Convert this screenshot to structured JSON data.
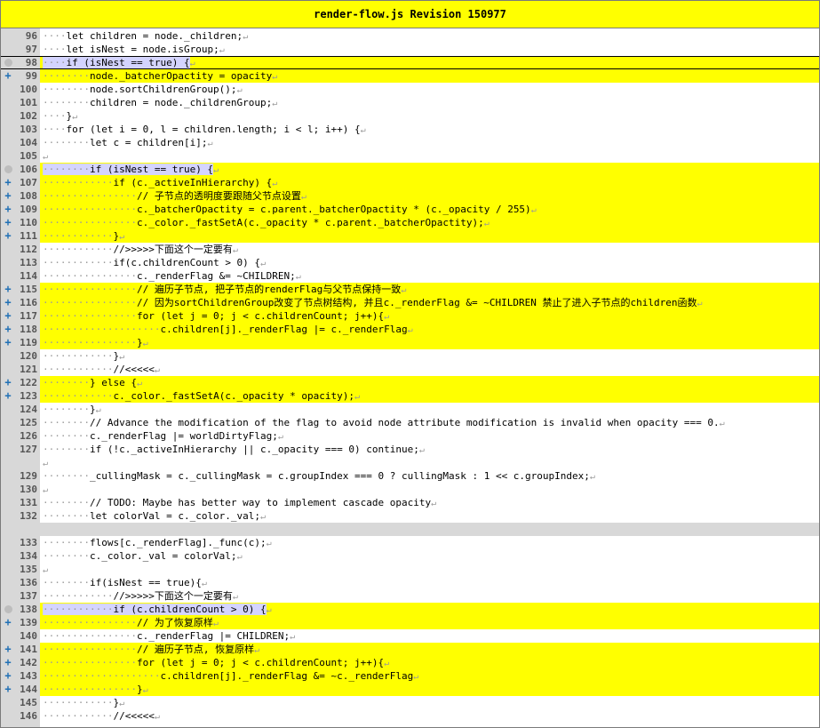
{
  "window": {
    "title": "render-flow.js Revision 150977"
  },
  "colors": {
    "highlight": "#ffff00",
    "gutter": "#d8d8d8",
    "marker": "#1f6fb5",
    "selection": "#d4d4ff"
  },
  "lines_top": [
    {
      "n": "96",
      "ind": 4,
      "code": "let children = node._children;",
      "hl": false,
      "mark": ""
    },
    {
      "n": "97",
      "ind": 4,
      "code": "let isNest = node.isGroup;",
      "hl": false,
      "mark": ""
    },
    {
      "n": "98",
      "ind": 4,
      "code": "if (isNest == true) {",
      "hl": true,
      "mark": "circle",
      "outlined": true,
      "sel": true
    },
    {
      "n": "99",
      "ind": 8,
      "code": "node._batcherOpactity = opacity",
      "hl": true,
      "mark": "plus"
    },
    {
      "n": "100",
      "ind": 8,
      "code": "node.sortChildrenGroup();",
      "hl": false,
      "mark": ""
    },
    {
      "n": "101",
      "ind": 8,
      "code": "children = node._childrenGroup;",
      "hl": false,
      "mark": ""
    },
    {
      "n": "102",
      "ind": 4,
      "code": "}",
      "hl": false,
      "mark": ""
    },
    {
      "n": "103",
      "ind": 4,
      "code": "for (let i = 0, l = children.length; i < l; i++) {",
      "hl": false,
      "mark": ""
    },
    {
      "n": "104",
      "ind": 8,
      "code": "let c = children[i];",
      "hl": false,
      "mark": ""
    },
    {
      "n": "105",
      "ind": 0,
      "code": "",
      "hl": false,
      "mark": ""
    },
    {
      "n": "106",
      "ind": 8,
      "code": "if (isNest == true) {",
      "hl": true,
      "mark": "circle",
      "sel": true
    },
    {
      "n": "107",
      "ind": 12,
      "code": "if (c._activeInHierarchy) {",
      "hl": true,
      "mark": "plus"
    },
    {
      "n": "108",
      "ind": 16,
      "code": "// 子节点的透明度要跟随父节点设置",
      "hl": true,
      "mark": "plus"
    },
    {
      "n": "109",
      "ind": 16,
      "code": "c._batcherOpactity = c.parent._batcherOpactity * (c._opacity / 255)",
      "hl": true,
      "mark": "plus"
    },
    {
      "n": "110",
      "ind": 16,
      "code": "c._color._fastSetA(c._opacity * c.parent._batcherOpactity);",
      "hl": true,
      "mark": "plus"
    },
    {
      "n": "111",
      "ind": 12,
      "code": "}",
      "hl": true,
      "mark": "plus"
    },
    {
      "n": "112",
      "ind": 12,
      "code": "//>>>>>下面这个一定要有",
      "hl": false,
      "mark": ""
    },
    {
      "n": "113",
      "ind": 12,
      "code": "if(c.childrenCount > 0) {",
      "hl": false,
      "mark": ""
    },
    {
      "n": "114",
      "ind": 16,
      "code": "c._renderFlag &= ~CHILDREN;",
      "hl": false,
      "mark": ""
    },
    {
      "n": "115",
      "ind": 16,
      "code": "// 遍历子节点, 把子节点的renderFlag与父节点保持一致",
      "hl": true,
      "mark": "plus"
    },
    {
      "n": "116",
      "ind": 16,
      "code": "// 因为sortChildrenGroup改变了节点树结构, 并且c._renderFlag &= ~CHILDREN 禁止了进入子节点的children函数",
      "hl": true,
      "mark": "plus"
    },
    {
      "n": "117",
      "ind": 16,
      "code": "for (let j = 0; j < c.childrenCount; j++){",
      "hl": true,
      "mark": "plus"
    },
    {
      "n": "118",
      "ind": 20,
      "code": "c.children[j]._renderFlag |= c._renderFlag",
      "hl": true,
      "mark": "plus"
    },
    {
      "n": "119",
      "ind": 16,
      "code": "}",
      "hl": true,
      "mark": "plus"
    },
    {
      "n": "120",
      "ind": 12,
      "code": "}",
      "hl": false,
      "mark": ""
    },
    {
      "n": "121",
      "ind": 12,
      "code": "//<<<<<",
      "hl": false,
      "mark": ""
    },
    {
      "n": "122",
      "ind": 8,
      "code": "} else {",
      "hl": true,
      "mark": "plus"
    },
    {
      "n": "123",
      "ind": 12,
      "code": "c._color._fastSetA(c._opacity * opacity);",
      "hl": true,
      "mark": "plus"
    },
    {
      "n": "124",
      "ind": 8,
      "code": "}",
      "hl": false,
      "mark": ""
    },
    {
      "n": "125",
      "ind": 8,
      "code": "// Advance the modification of the flag to avoid node attribute modification is invalid when opacity === 0.",
      "hl": false,
      "mark": ""
    },
    {
      "n": "126",
      "ind": 8,
      "code": "c._renderFlag |= worldDirtyFlag;",
      "hl": false,
      "mark": ""
    },
    {
      "n": "127",
      "ind": 8,
      "code": "if (!c._activeInHierarchy || c._opacity === 0) continue;",
      "hl": false,
      "mark": ""
    },
    {
      "n": "",
      "ind": 0,
      "code": "",
      "hl": false,
      "mark": ""
    },
    {
      "n": "129",
      "ind": 8,
      "code": "_cullingMask = c._cullingMask = c.groupIndex === 0 ? cullingMask : 1 << c.groupIndex;",
      "hl": false,
      "mark": ""
    },
    {
      "n": "130",
      "ind": 0,
      "code": "",
      "hl": false,
      "mark": ""
    },
    {
      "n": "131",
      "ind": 8,
      "code": "// TODO: Maybe has better way to implement cascade opacity",
      "hl": false,
      "mark": ""
    },
    {
      "n": "132",
      "ind": 8,
      "code": "let colorVal = c._color._val;",
      "hl": false,
      "mark": ""
    }
  ],
  "lines_bottom": [
    {
      "n": "133",
      "ind": 8,
      "code": "flows[c._renderFlag]._func(c);",
      "hl": false,
      "mark": ""
    },
    {
      "n": "134",
      "ind": 8,
      "code": "c._color._val = colorVal;",
      "hl": false,
      "mark": ""
    },
    {
      "n": "135",
      "ind": 0,
      "code": "",
      "hl": false,
      "mark": ""
    },
    {
      "n": "136",
      "ind": 8,
      "code": "if(isNest == true){",
      "hl": false,
      "mark": ""
    },
    {
      "n": "137",
      "ind": 12,
      "code": "//>>>>>下面这个一定要有",
      "hl": false,
      "mark": ""
    },
    {
      "n": "138",
      "ind": 12,
      "code": "if (c.childrenCount > 0) {",
      "hl": true,
      "mark": "circle",
      "sel": true
    },
    {
      "n": "139",
      "ind": 16,
      "code": "// 为了恢复原样",
      "hl": true,
      "mark": "plus"
    },
    {
      "n": "140",
      "ind": 16,
      "code": "c._renderFlag |= CHILDREN;",
      "hl": false,
      "mark": ""
    },
    {
      "n": "141",
      "ind": 16,
      "code": "// 遍历子节点, 恢复原样",
      "hl": true,
      "mark": "plus"
    },
    {
      "n": "142",
      "ind": 16,
      "code": "for (let j = 0; j < c.childrenCount; j++){",
      "hl": true,
      "mark": "plus"
    },
    {
      "n": "143",
      "ind": 20,
      "code": "c.children[j]._renderFlag &= ~c._renderFlag",
      "hl": true,
      "mark": "plus"
    },
    {
      "n": "144",
      "ind": 16,
      "code": "}",
      "hl": true,
      "mark": "plus"
    },
    {
      "n": "145",
      "ind": 12,
      "code": "}",
      "hl": false,
      "mark": ""
    },
    {
      "n": "146",
      "ind": 12,
      "code": "//<<<<<",
      "hl": false,
      "mark": ""
    }
  ]
}
